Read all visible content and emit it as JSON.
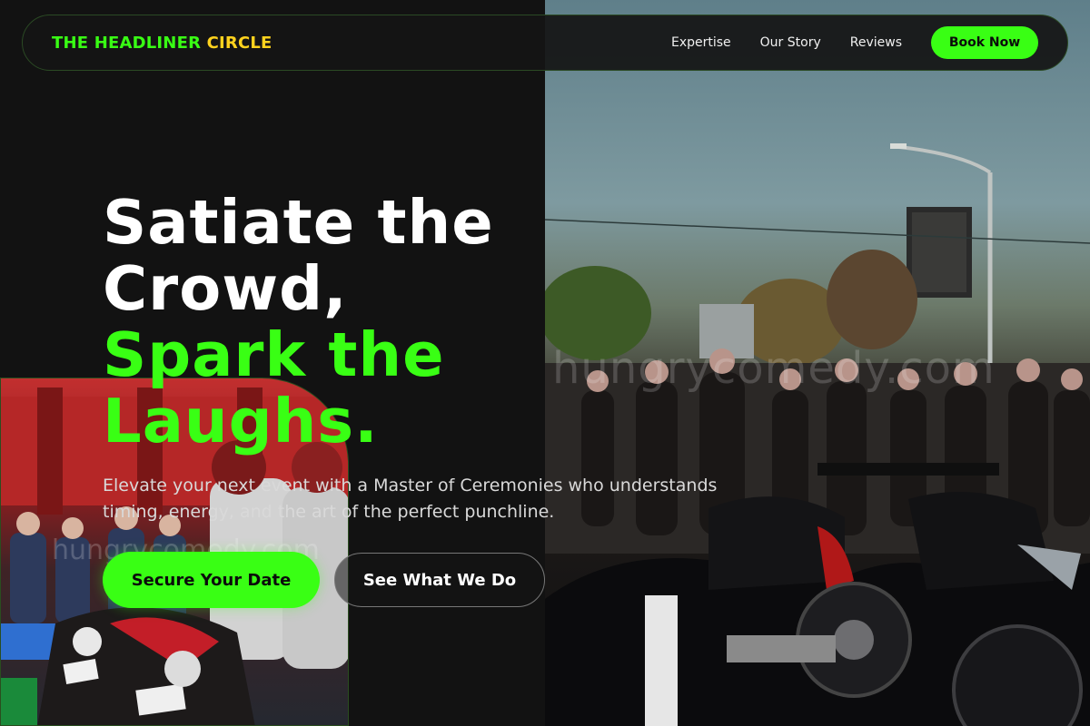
{
  "header": {
    "brand_part1": "THE HEADLINER",
    "brand_part2": "CIRCLE",
    "nav": [
      {
        "label": "Expertise"
      },
      {
        "label": "Our Story"
      },
      {
        "label": "Reviews"
      }
    ],
    "cta_label": "Book Now"
  },
  "hero": {
    "title_white": [
      "Satiate the",
      "Crowd,"
    ],
    "title_green": [
      "Spark the",
      "Laughs."
    ],
    "subtitle": "Elevate your next event with a Master of Ceremonies who understands timing, energy, and the art of the perfect punchline.",
    "primary_cta": "Secure Your Date",
    "secondary_cta": "See What We Do"
  },
  "photos": {
    "right_watermark": "hungrycomedy.com",
    "inset_watermark": "hungrycomedy.com"
  },
  "colors": {
    "accent_green": "#39ff14",
    "accent_yellow": "#ffd21e",
    "background": "#121212"
  }
}
